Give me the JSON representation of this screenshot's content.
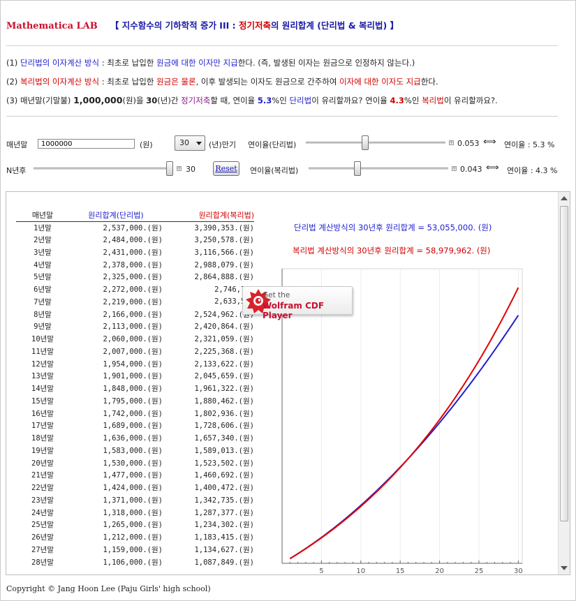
{
  "header": {
    "brand": "Mathematica LAB",
    "title_pre": "【 지수함수의 기하학적 증가 III : ",
    "title_highlight": "정기저축",
    "title_post": "의 원리합계 (단리법 & 복리법) 】"
  },
  "description": {
    "line1": {
      "n": "(1) ",
      "a": "단리법의 이자계산 방식",
      "b": " : 최초로 납입한 ",
      "c": "원금에 대한 이자만 지급",
      "d": "한다. (즉, 발생된 이자는 원금으로 인정하지 않는다.)"
    },
    "line2": {
      "n": "(2) ",
      "a": "복리법의 이자계산 방식",
      "b": " : 최초로 납입한 ",
      "c": "원금은 물론",
      "d": ", 이후 발생되는 이자도 원금으로 간주하여 ",
      "e": "이자에 대한 이자도 지급",
      "f": "한다."
    },
    "line3": {
      "a": "(3) 매년말(기말불) ",
      "amount": "1,000,000",
      "b": "(원)을  ",
      "years": "30",
      "c": "(년)간 ",
      "d": "정기저축",
      "e": "할 때, 연이율 ",
      "r1": "5.3",
      "f": "%인 ",
      "g": "단리법",
      "h": "이 유리할까요? 연이율 ",
      "r2": "4.3",
      "i": "%인 ",
      "j": "복리법",
      "k": "이 유리할까요?."
    }
  },
  "controls": {
    "deposit_label": "매년말",
    "deposit_value": "1000000",
    "deposit_unit": "(원)",
    "years_selected": "30",
    "years_unit": "(년)만기",
    "simple_rate_label": "연이율(단리법)",
    "simple_rate_value": "0.053",
    "simple_rate_display": "연이율 : 5.3 %",
    "simple_rate_fraction": 0.42,
    "n_label": "N년후",
    "n_value": "30",
    "n_fraction": 1.0,
    "reset_label": "Reset",
    "compound_rate_label": "연이율(복리법)",
    "compound_rate_value": "0.043",
    "compound_rate_display": "연이율 : 4.3 %",
    "compound_rate_fraction": 0.34,
    "arrow": "⟺"
  },
  "results": {
    "simple_summary": "단리법 계산방식의 30년후 원리합계 = 53,055,000. (원)",
    "compound_summary": "복리법 계산방식의 30년후 원리합계 = 58,979,962. (원)"
  },
  "table": {
    "headers": [
      "매년말",
      "원리합계(단리법)",
      "원리합계(복리법)"
    ],
    "rows": [
      [
        "1년말",
        "2,537,000.(원)",
        "3,390,353.(원)"
      ],
      [
        "2년말",
        "2,484,000.(원)",
        "3,250,578.(원)"
      ],
      [
        "3년말",
        "2,431,000.(원)",
        "3,116,566.(원)"
      ],
      [
        "4년말",
        "2,378,000.(원)",
        "2,988,079.(원)"
      ],
      [
        "5년말",
        "2,325,000.(원)",
        "2,864,888.(원)"
      ],
      [
        "6년말",
        "2,272,000.(원)",
        "2,746,777"
      ],
      [
        "7년말",
        "2,219,000.(원)",
        "2,633,535"
      ],
      [
        "8년말",
        "2,166,000.(원)",
        "2,524,962.(원)"
      ],
      [
        "9년말",
        "2,113,000.(원)",
        "2,420,864.(원)"
      ],
      [
        "10년말",
        "2,060,000.(원)",
        "2,321,059.(원)"
      ],
      [
        "11년말",
        "2,007,000.(원)",
        "2,225,368.(원)"
      ],
      [
        "12년말",
        "1,954,000.(원)",
        "2,133,622.(원)"
      ],
      [
        "13년말",
        "1,901,000.(원)",
        "2,045,659.(원)"
      ],
      [
        "14년말",
        "1,848,000.(원)",
        "1,961,322.(원)"
      ],
      [
        "15년말",
        "1,795,000.(원)",
        "1,880,462.(원)"
      ],
      [
        "16년말",
        "1,742,000.(원)",
        "1,802,936.(원)"
      ],
      [
        "17년말",
        "1,689,000.(원)",
        "1,728,606.(원)"
      ],
      [
        "18년말",
        "1,636,000.(원)",
        "1,657,340.(원)"
      ],
      [
        "19년말",
        "1,583,000.(원)",
        "1,589,013.(원)"
      ],
      [
        "20년말",
        "1,530,000.(원)",
        "1,523,502.(원)"
      ],
      [
        "21년말",
        "1,477,000.(원)",
        "1,460,692.(원)"
      ],
      [
        "22년말",
        "1,424,000.(원)",
        "1,400,472.(원)"
      ],
      [
        "23년말",
        "1,371,000.(원)",
        "1,342,735.(원)"
      ],
      [
        "24년말",
        "1,318,000.(원)",
        "1,287,377.(원)"
      ],
      [
        "25년말",
        "1,265,000.(원)",
        "1,234,302.(원)"
      ],
      [
        "26년말",
        "1,212,000.(원)",
        "1,183,415.(원)"
      ],
      [
        "27년말",
        "1,159,000.(원)",
        "1,134,627.(원)"
      ],
      [
        "28년말",
        "1,106,000.(원)",
        "1,087,849.(원)"
      ]
    ]
  },
  "cdf_badge": {
    "line1": "Get the",
    "line2": "Wolfram CDF Player"
  },
  "footer": {
    "copyright": "Copyright © Jang Hoon Lee (Paju Girls' high school)"
  },
  "colors": {
    "simple": "#1f1fcf",
    "compound": "#e00000",
    "brand": "#c8102e"
  },
  "chart_data": {
    "type": "line",
    "x_ticks": [
      5,
      10,
      15,
      20,
      25,
      30
    ],
    "xlim": [
      0,
      30.5
    ],
    "ylim": [
      0,
      63000000
    ],
    "grid": true,
    "series": [
      {
        "key": "simple",
        "color": "#1f1fcf",
        "rate": 0.053,
        "method": "simple",
        "deposit": 1000000,
        "n": 30
      },
      {
        "key": "compound",
        "color": "#e00000",
        "rate": 0.043,
        "method": "compound",
        "deposit": 1000000,
        "n": 30
      }
    ]
  }
}
